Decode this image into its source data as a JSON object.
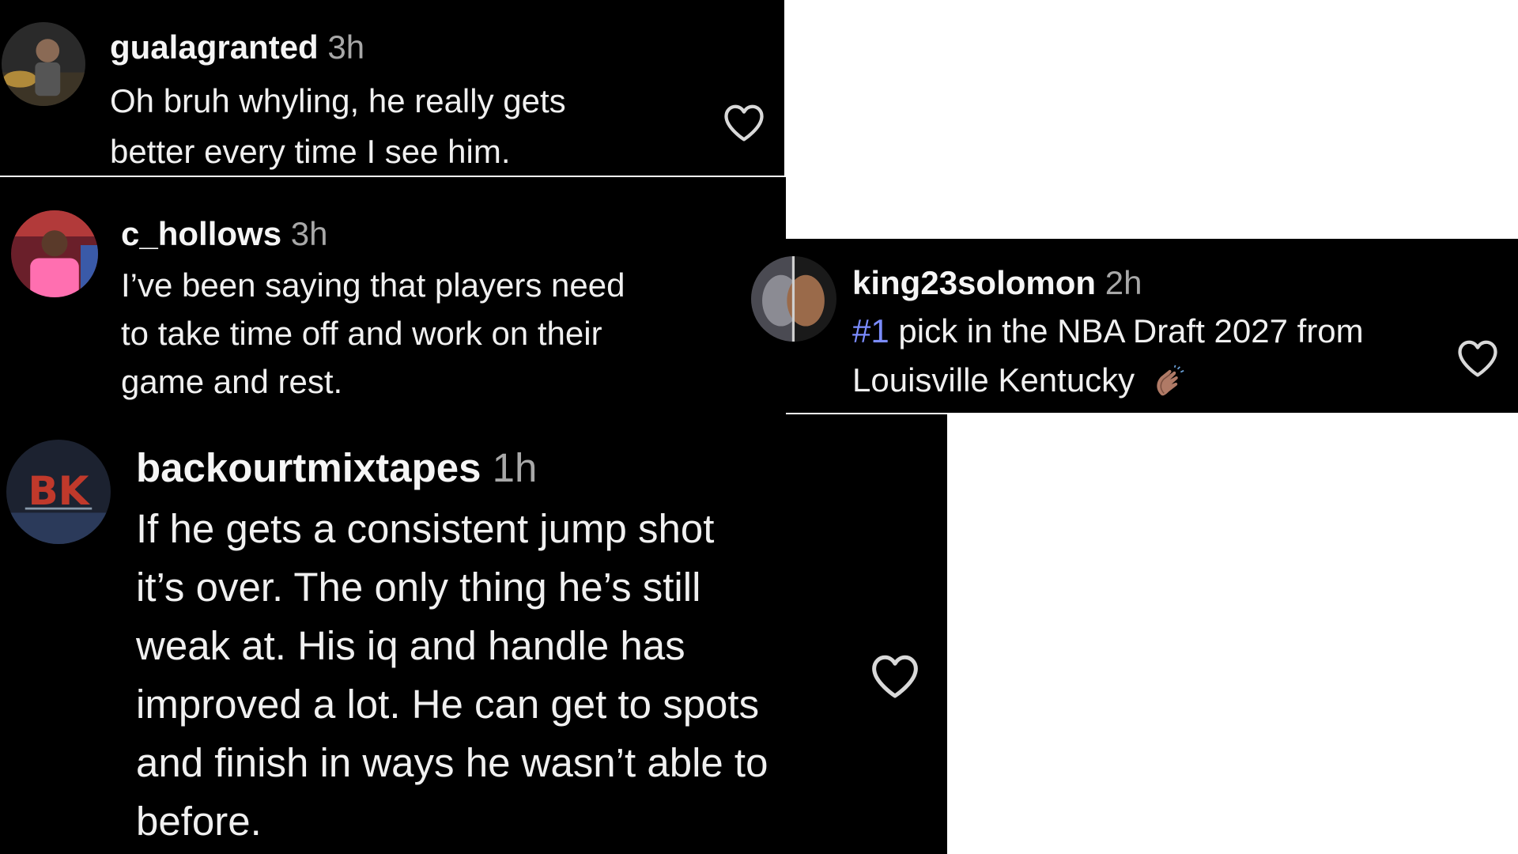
{
  "comments": [
    {
      "username": "gualagranted",
      "time": "3h",
      "lines": [
        "Oh bruh whyling, he really gets",
        "better every time I see him."
      ]
    },
    {
      "username": "c_hollows",
      "time": "3h",
      "lines": [
        "I’ve been saying that players need",
        "to take time off and work on their",
        "game and rest."
      ]
    },
    {
      "username": "king23solomon",
      "time": "2h",
      "hashtag": "#1",
      "line1_rest": " pick in the NBA Draft 2027 from",
      "line2": "Louisville Kentucky",
      "emoji_name": "clapping-hands-emoji"
    },
    {
      "username": "backourtmixtapes",
      "time": "1h",
      "lines": [
        "If he gets a consistent jump shot",
        "it’s over. The only thing he’s still",
        "weak at. His iq and handle has",
        "improved a lot. He can get to spots",
        "and finish in ways he wasn’t able to",
        "before."
      ]
    }
  ],
  "icons": {
    "like": "heart-outline-icon"
  },
  "colors": {
    "card_background": "#000000",
    "text": "#f0f0f0",
    "timestamp": "#a8a8a8",
    "hashtag": "#7b8cff"
  }
}
